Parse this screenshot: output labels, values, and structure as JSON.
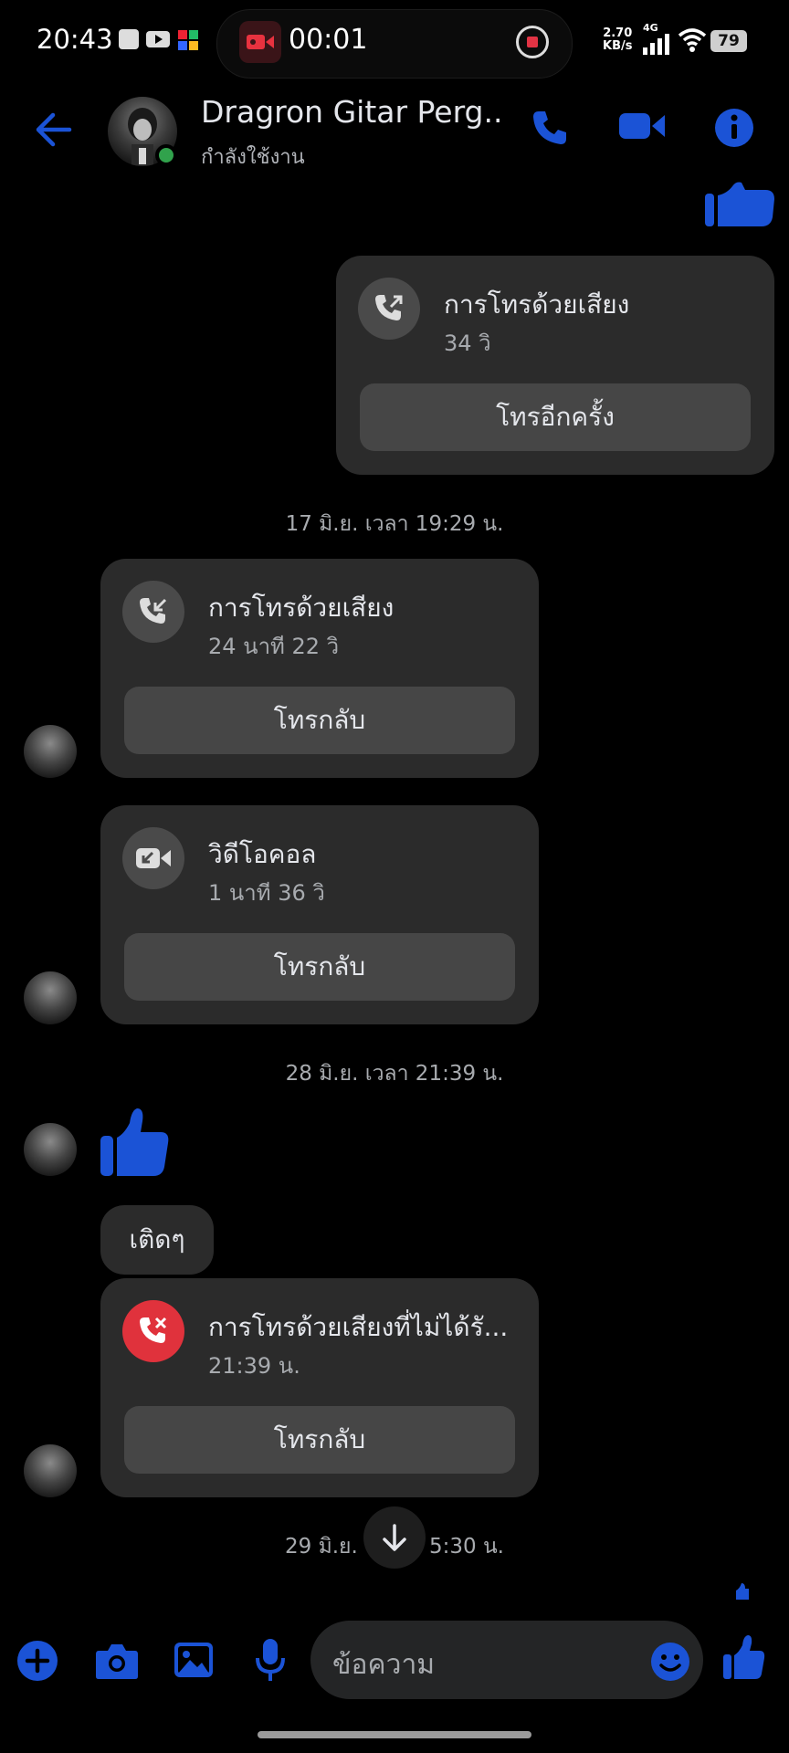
{
  "status_bar": {
    "time": "20:43",
    "recording_time": "00:01",
    "net_speed_value": "2.70",
    "net_speed_unit": "KB/s",
    "network": "4G",
    "battery": "79"
  },
  "header": {
    "contact_name": "Dragron Gitar Perg...",
    "status": "กำลังใช้งาน"
  },
  "messages": {
    "call1": {
      "title": "การโทรด้วยเสียง",
      "duration": "34 วิ",
      "button": "โทรอีกครั้ง"
    },
    "ts1": "17 มิ.ย. เวลา 19:29 น.",
    "call2": {
      "title": "การโทรด้วยเสียง",
      "duration": "24 นาที 22 วิ",
      "button": "โทรกลับ"
    },
    "call3": {
      "title": "วิดีโอคอล",
      "duration": "1 นาที 36 วิ",
      "button": "โทรกลับ"
    },
    "ts2": "28 มิ.ย. เวลา 21:39 น.",
    "text1": "เติดๆ",
    "call4": {
      "title": "การโทรด้วยเสียงที่ไม่ได้รั...",
      "duration": "21:39 น.",
      "button": "โทรกลับ"
    },
    "ts3_left": "29 มิ.ย.",
    "ts3_right": "5:30 น."
  },
  "composer": {
    "placeholder": "ข้อความ"
  },
  "colors": {
    "accent": "#1b53d6",
    "bubble": "#2b2b2b",
    "missed": "#e0323c",
    "online": "#31a24c"
  }
}
